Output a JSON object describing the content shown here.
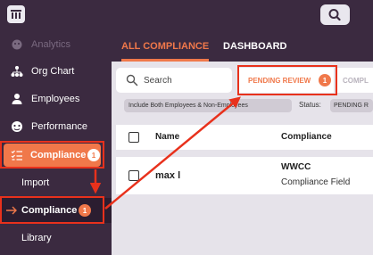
{
  "sidebar": {
    "items": [
      {
        "label": "Analytics",
        "icon": "analytics-icon"
      },
      {
        "label": "Org Chart",
        "icon": "org-chart-icon"
      },
      {
        "label": "Employees",
        "icon": "person-icon"
      },
      {
        "label": "Performance",
        "icon": "performance-icon"
      },
      {
        "label": "Compliance",
        "icon": "checklist-icon",
        "badge": "1"
      },
      {
        "label": "Import"
      },
      {
        "label": "Compliance",
        "icon": "arrow-right-icon",
        "badge": "1"
      },
      {
        "label": "Library"
      }
    ]
  },
  "tabs": [
    {
      "label": "ALL COMPLIANCE"
    },
    {
      "label": "DASHBOARD"
    }
  ],
  "search": {
    "label": "Search"
  },
  "review_tabs": {
    "pending": {
      "label": "PENDING REVIEW",
      "badge": "1"
    },
    "complete": {
      "label": "COMPL"
    }
  },
  "filters": {
    "include_chip": "Include Both Employees & Non-Employees",
    "status_label": "Status:",
    "status_chip": "PENDING R"
  },
  "table": {
    "headers": {
      "name": "Name",
      "compliance": "Compliance"
    },
    "rows": [
      {
        "name": "max l",
        "compliance": "WWCC",
        "field": "Compliance Field"
      }
    ]
  },
  "colors": {
    "accent": "#f0784a",
    "sidebar": "#3b2a40",
    "annotation": "#e8311c"
  }
}
